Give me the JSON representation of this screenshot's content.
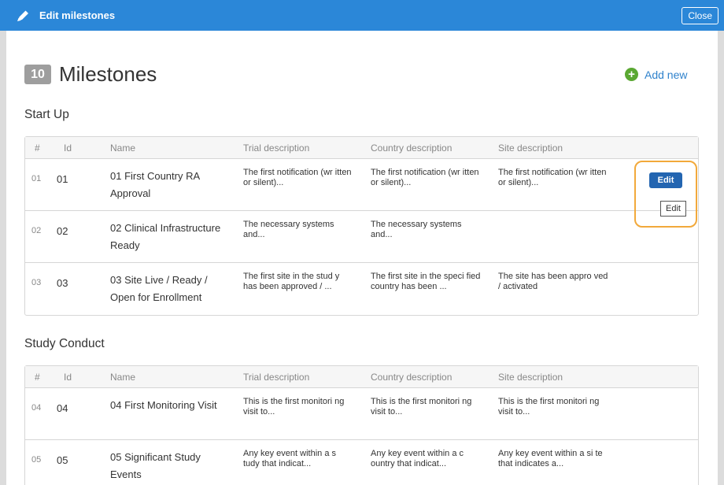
{
  "topbar": {
    "title": "Edit milestones",
    "close_label": "Close",
    "icon": "pencil-icon"
  },
  "heading": {
    "count": "10",
    "label": "Milestones"
  },
  "add_new": {
    "label": "Add new",
    "icon": "plus-circle-icon"
  },
  "columns": [
    "#",
    "Id",
    "Name",
    "Trial description",
    "Country description",
    "Site description"
  ],
  "sections": [
    {
      "title": "Start Up",
      "rows": [
        {
          "num": "01",
          "id": "01",
          "name": "01 First Country RA Approval",
          "trial": "The first notification (wr itten or silent)...",
          "country": "The first notification (wr itten or silent)...",
          "site": "The first notification (wr itten or silent)..."
        },
        {
          "num": "02",
          "id": "02",
          "name": "02 Clinical Infrastructure Ready",
          "trial": "The necessary systems and...",
          "country": "The necessary systems and...",
          "site": ""
        },
        {
          "num": "03",
          "id": "03",
          "name": "03 Site Live / Ready / Open for Enrollment",
          "trial": "The first site in the stud y has been approved / ...",
          "country": "The first site in the speci fied country has been ...",
          "site": "The site has been appro ved / activated"
        }
      ]
    },
    {
      "title": "Study Conduct",
      "rows": [
        {
          "num": "04",
          "id": "04",
          "name": "04 First Monitoring Visit",
          "trial": "This is the first monitori ng visit to...",
          "country": "This is the first monitori ng visit to...",
          "site": "This is the first monitori ng visit to..."
        },
        {
          "num": "05",
          "id": "05",
          "name": "05 Significant Study Events",
          "trial": "Any key event within a s tudy that indicat...",
          "country": "Any key event within a c ountry that indicat...",
          "site": "Any key event within a si te that indicates a..."
        }
      ]
    }
  ],
  "edit_button": {
    "label": "Edit"
  },
  "tooltip": {
    "text": "Edit"
  },
  "colors": {
    "topbar": "#2b87d8",
    "edit_button": "#2365b1",
    "add_icon": "#5aa832",
    "highlight": "#f2a93b",
    "link": "#2f82cc"
  }
}
